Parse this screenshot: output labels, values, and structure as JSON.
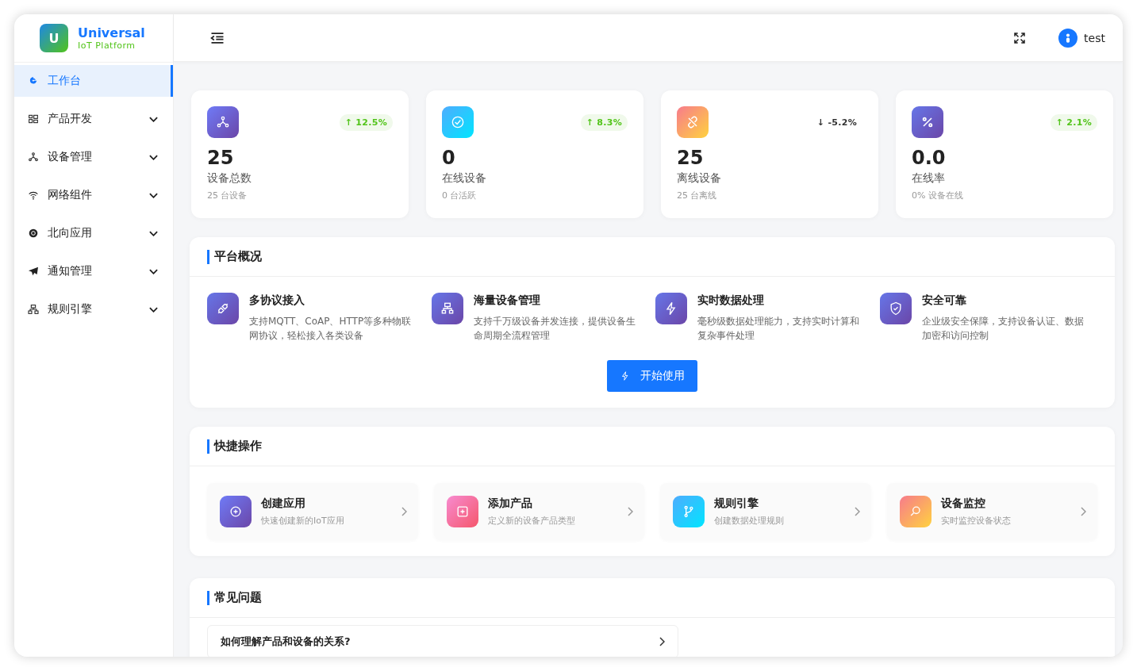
{
  "logo": {
    "mark": "U",
    "title": "Universal",
    "subtitle": "IoT Platform"
  },
  "sidebar": {
    "items": [
      {
        "label": "工作台",
        "kind": "link",
        "selected": true
      },
      {
        "label": "产品开发",
        "kind": "group",
        "selected": false,
        "expanded": false
      },
      {
        "label": "设备管理",
        "kind": "group",
        "selected": false,
        "expanded": false
      },
      {
        "label": "网络组件",
        "kind": "group",
        "selected": false,
        "expanded": false
      },
      {
        "label": "北向应用",
        "kind": "group",
        "selected": false,
        "expanded": false
      },
      {
        "label": "通知管理",
        "kind": "group",
        "selected": false,
        "expanded": false
      },
      {
        "label": "规则引擎",
        "kind": "group",
        "selected": false,
        "expanded": false
      }
    ]
  },
  "header": {
    "user": "test"
  },
  "stats": [
    {
      "value": "25",
      "label": "设备总数",
      "sub": "25 台设备",
      "trend": "↑ 12.5%",
      "up": true
    },
    {
      "value": "0",
      "label": "在线设备",
      "sub": "0 台活跃",
      "trend": "↑ 8.3%",
      "up": true
    },
    {
      "value": "25",
      "label": "离线设备",
      "sub": "25 台离线",
      "trend": "↓ -5.2%",
      "up": false
    },
    {
      "value": "0.0",
      "label": "在线率",
      "sub": "0% 设备在线",
      "trend": "↑ 2.1%",
      "up": true
    }
  ],
  "overview": {
    "title": "平台概况",
    "features": [
      {
        "title": "多协议接入",
        "desc": "支持MQTT、CoAP、HTTP等多种物联网协议，轻松接入各类设备"
      },
      {
        "title": "海量设备管理",
        "desc": "支持千万级设备并发连接，提供设备生命周期全流程管理"
      },
      {
        "title": "实时数据处理",
        "desc": "毫秒级数据处理能力，支持实时计算和复杂事件处理"
      },
      {
        "title": "安全可靠",
        "desc": "企业级安全保障，支持设备认证、数据加密和访问控制"
      }
    ],
    "button": "开始使用"
  },
  "quick": {
    "title": "快捷操作",
    "actions": [
      {
        "title": "创建应用",
        "sub": "快速创建新的IoT应用"
      },
      {
        "title": "添加产品",
        "sub": "定义新的设备产品类型"
      },
      {
        "title": "规则引擎",
        "sub": "创建数据处理规则"
      },
      {
        "title": "设备监控",
        "sub": "实时监控设备状态"
      }
    ]
  },
  "faq": {
    "title": "常见问题",
    "items": [
      {
        "question": "如何理解产品和设备的关系?"
      }
    ]
  }
}
